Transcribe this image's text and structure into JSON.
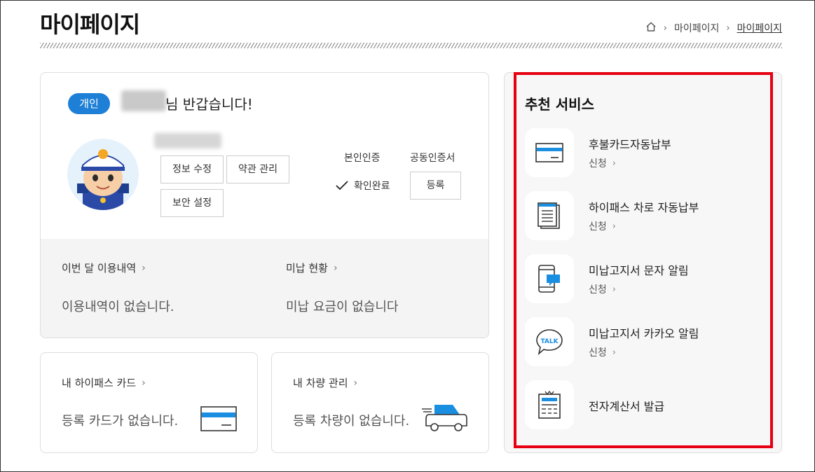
{
  "header": {
    "title": "마이페이지",
    "breadcrumb": [
      "마이페이지",
      "마이페이지"
    ]
  },
  "profile": {
    "badge": "개인",
    "greeting": "님 반갑습니다!",
    "buttons": {
      "edit": "정보 수정",
      "terms": "약관 관리",
      "security": "보안 설정"
    },
    "identity_label": "본인인증",
    "identity_status": "확인완료",
    "cert_label": "공동인증서",
    "cert_button": "등록"
  },
  "usage": {
    "monthly_title": "이번 달 이용내역",
    "monthly_empty": "이용내역이 없습니다.",
    "unpaid_title": "미납 현황",
    "unpaid_empty": "미납 요금이 없습니다"
  },
  "hipass_card": {
    "title": "내 하이패스 카드",
    "empty": "등록 카드가 없습니다."
  },
  "vehicle": {
    "title": "내 차량 관리",
    "empty": "등록 차량이 없습니다."
  },
  "services": {
    "title": "추천 서비스",
    "items": [
      {
        "name": "후불카드자동납부",
        "action": "신청",
        "icon": "credit-card-icon"
      },
      {
        "name": "하이패스 차로 자동납부",
        "action": "신청",
        "icon": "document-icon"
      },
      {
        "name": "미납고지서 문자 알림",
        "action": "신청",
        "icon": "mobile-message-icon"
      },
      {
        "name": "미납고지서 카카오 알림",
        "action": "신청",
        "icon": "talk-bubble-icon"
      },
      {
        "name": "전자계산서 발급",
        "icon": "receipt-icon"
      }
    ]
  },
  "colors": {
    "accent": "#1d7fd6",
    "highlight": "#e60012",
    "icon_blue": "#1a8ee0"
  }
}
